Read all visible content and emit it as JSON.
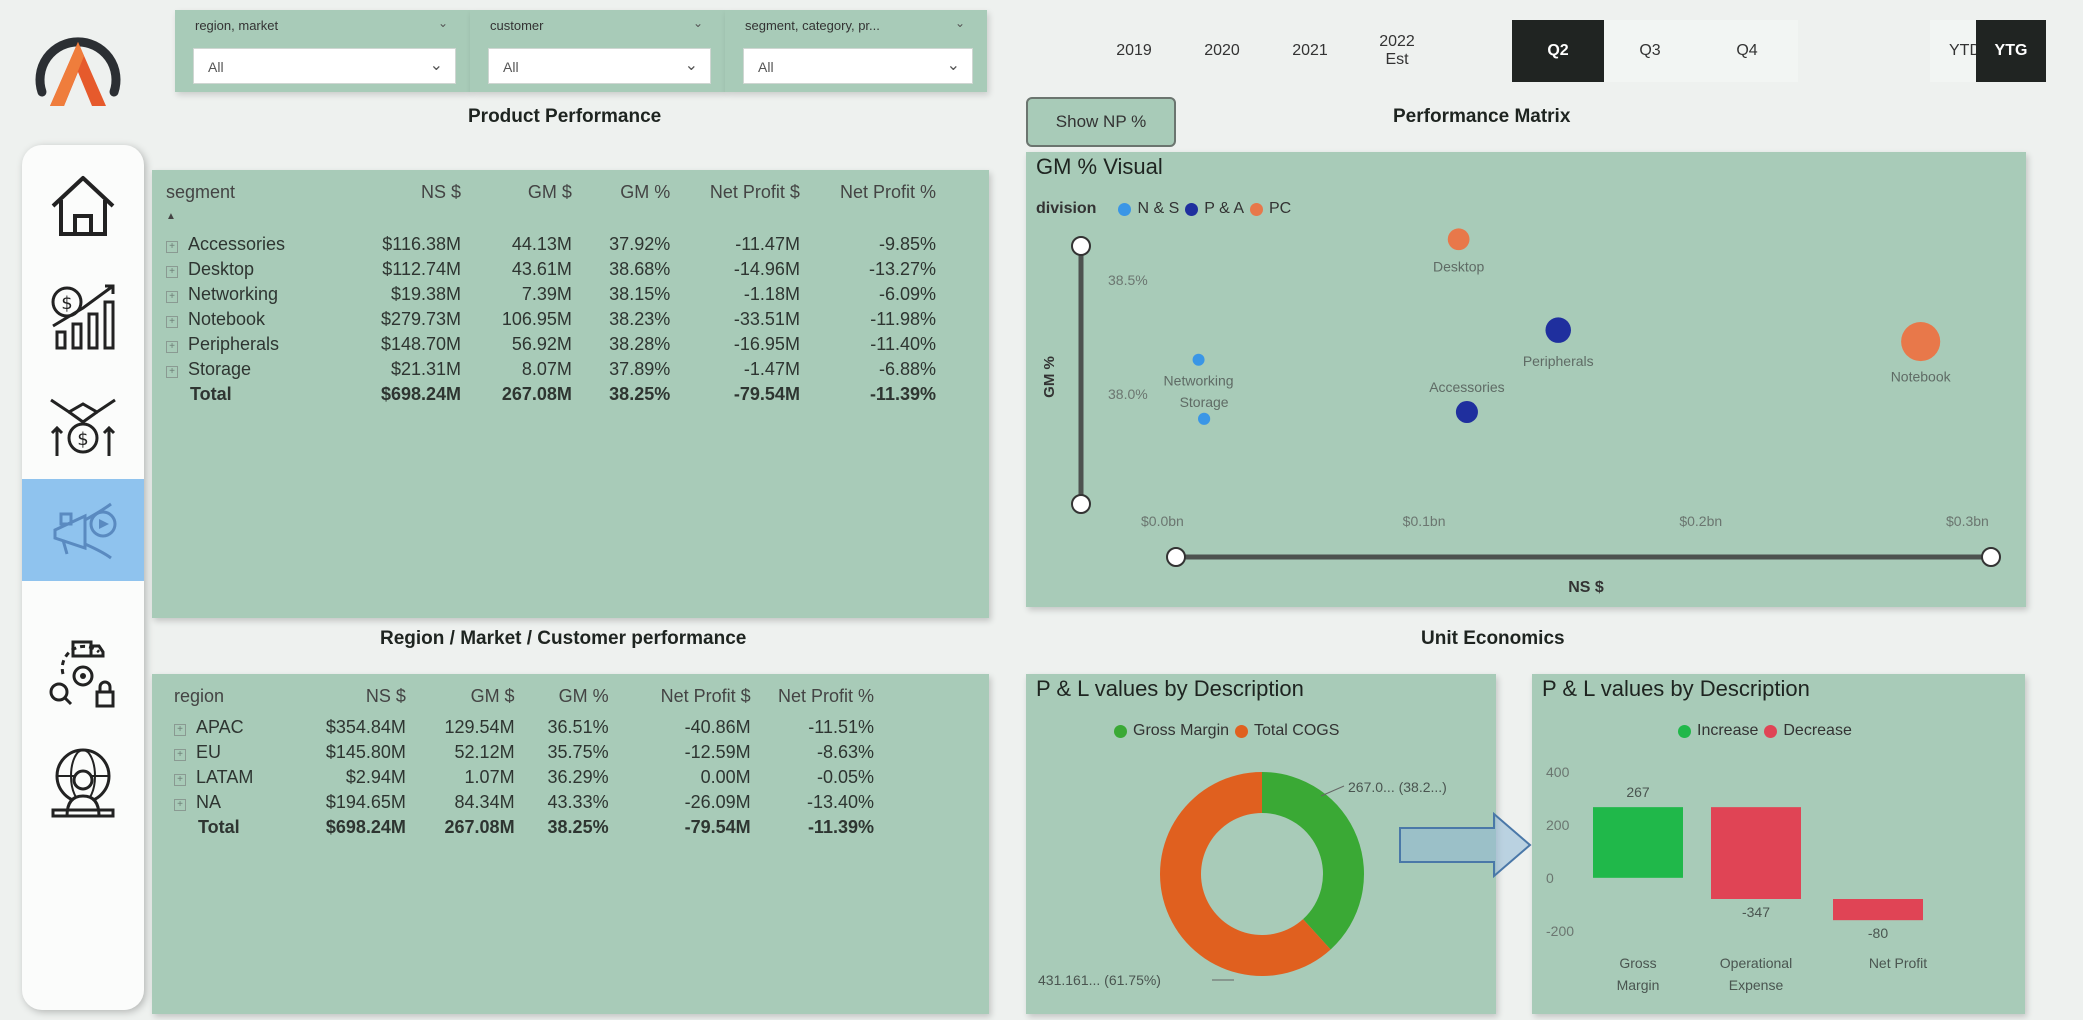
{
  "filters": [
    {
      "label": "region, market",
      "value": "All"
    },
    {
      "label": "customer",
      "value": "All"
    },
    {
      "label": "segment, category, pr...",
      "value": "All"
    }
  ],
  "periods": {
    "years": [
      "2019",
      "2020",
      "2021"
    ],
    "est_year": "2022",
    "est_label": "Est",
    "quarters": [
      "Q2",
      "Q3",
      "Q4"
    ],
    "active_quarter": "Q2",
    "modes": [
      "YTD",
      "YTG"
    ],
    "active_mode": "YTG"
  },
  "headings": {
    "product": "Product Performance",
    "matrix": "Performance Matrix",
    "region": "Region / Market / Customer performance",
    "unit": "Unit Economics"
  },
  "show_np_button": "Show NP %",
  "sidebar": {
    "items": [
      "home-icon",
      "finance-growth-icon",
      "sales-deal-icon",
      "marketing-icon",
      "supply-chain-icon",
      "executive-globe-icon"
    ],
    "active_index": 3
  },
  "product_table": {
    "columns": [
      "segment",
      "NS $",
      "GM $",
      "GM %",
      "Net Profit $",
      "Net Profit %"
    ],
    "rows": [
      [
        "Accessories",
        "$116.38M",
        "44.13M",
        "37.92%",
        "-11.47M",
        "-9.85%"
      ],
      [
        "Desktop",
        "$112.74M",
        "43.61M",
        "38.68%",
        "-14.96M",
        "-13.27%"
      ],
      [
        "Networking",
        "$19.38M",
        "7.39M",
        "38.15%",
        "-1.18M",
        "-6.09%"
      ],
      [
        "Notebook",
        "$279.73M",
        "106.95M",
        "38.23%",
        "-33.51M",
        "-11.98%"
      ],
      [
        "Peripherals",
        "$148.70M",
        "56.92M",
        "38.28%",
        "-16.95M",
        "-11.40%"
      ],
      [
        "Storage",
        "$21.31M",
        "8.07M",
        "37.89%",
        "-1.47M",
        "-6.88%"
      ]
    ],
    "total": [
      "Total",
      "$698.24M",
      "267.08M",
      "38.25%",
      "-79.54M",
      "-11.39%"
    ]
  },
  "region_table": {
    "columns": [
      "region",
      "NS $",
      "GM $",
      "GM %",
      "Net Profit $",
      "Net Profit %"
    ],
    "rows": [
      [
        "APAC",
        "$354.84M",
        "129.54M",
        "36.51%",
        "-40.86M",
        "-11.51%"
      ],
      [
        "EU",
        "$145.80M",
        "52.12M",
        "35.75%",
        "-12.59M",
        "-8.63%"
      ],
      [
        "LATAM",
        "$2.94M",
        "1.07M",
        "36.29%",
        "0.00M",
        "-0.05%"
      ],
      [
        "NA",
        "$194.65M",
        "84.34M",
        "43.33%",
        "-26.09M",
        "-13.40%"
      ]
    ],
    "total": [
      "Total",
      "$698.24M",
      "267.08M",
      "38.25%",
      "-79.54M",
      "-11.39%"
    ]
  },
  "colors": {
    "panel": "#a8cbb8",
    "ns": "#3a96e6",
    "pa": "#1f2f9e",
    "pc": "#e8784a",
    "gross_margin": "#3aa935",
    "cogs": "#e0601f",
    "increase": "#20b84a",
    "decrease": "#e04455",
    "active_nav": "#8fc3ee"
  },
  "chart_data": [
    {
      "type": "scatter",
      "title": "GM % Visual",
      "legend_title": "division",
      "series": [
        {
          "name": "N & S",
          "points": [
            {
              "label": "Networking",
              "x": 0.019,
              "y": 38.15
            },
            {
              "label": "Storage",
              "x": 0.021,
              "y": 37.89
            }
          ]
        },
        {
          "name": "P & A",
          "points": [
            {
              "label": "Peripherals",
              "x": 0.149,
              "y": 38.28
            },
            {
              "label": "Accessories",
              "x": 0.116,
              "y": 37.92
            }
          ]
        },
        {
          "name": "PC",
          "points": [
            {
              "label": "Desktop",
              "x": 0.113,
              "y": 38.68
            },
            {
              "label": "Notebook",
              "x": 0.28,
              "y": 38.23
            }
          ]
        }
      ],
      "xlabel": "NS $",
      "ylabel": "GM %",
      "x_ticks": [
        "$0.0bn",
        "$0.1bn",
        "$0.2bn",
        "$0.3bn"
      ],
      "y_ticks": [
        "38.5%",
        "38.0%"
      ],
      "xlim": [
        0,
        0.3
      ],
      "ylim": [
        37.7,
        38.8
      ]
    },
    {
      "type": "pie",
      "title": "P & L values by Description",
      "categories": [
        "Gross Margin",
        "Total COGS"
      ],
      "values": [
        267.08,
        431.16
      ],
      "data_labels": [
        "267.0... (38.2...)",
        "431.161... (61.75%)"
      ]
    },
    {
      "type": "bar",
      "subtype": "waterfall",
      "title": "P & L values by Description",
      "legend": [
        "Increase",
        "Decrease"
      ],
      "categories": [
        "Gross Margin",
        "Operational Expense",
        "Net Profit"
      ],
      "category_lines": [
        [
          "Gross",
          "Margin"
        ],
        [
          "Operational",
          "Expense"
        ],
        [
          "Net Profit"
        ]
      ],
      "values": [
        267,
        -347,
        -80
      ],
      "data_labels": [
        "267",
        "-347",
        "-80"
      ],
      "y_ticks": [
        "400",
        "200",
        "0",
        "-200"
      ],
      "ylim": [
        -250,
        430
      ]
    }
  ]
}
